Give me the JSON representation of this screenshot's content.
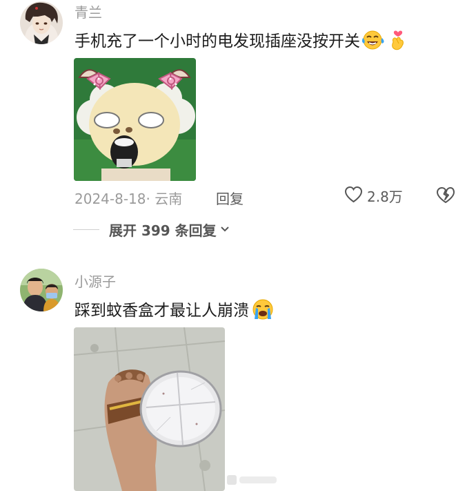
{
  "comments": [
    {
      "username": "青兰",
      "text": "手机充了一个小时的电发现插座没按开关",
      "emojis": [
        "laughing-crying-emoji",
        "finger-heart-emoji"
      ],
      "date": "2024-8-18",
      "location": "云南",
      "meta_text": "2024-8-18· 云南",
      "reply_label": "回复",
      "likes": "2.8万",
      "expand_label": "展开 399 条回复"
    },
    {
      "username": "小源子",
      "text": "踩到蚊香盒才最让人崩溃",
      "emojis": [
        "crying-emoji"
      ]
    }
  ],
  "colors": {
    "username": "#9a9a9a",
    "text": "#1c1c1c",
    "secondary": "#5a5a5a"
  }
}
